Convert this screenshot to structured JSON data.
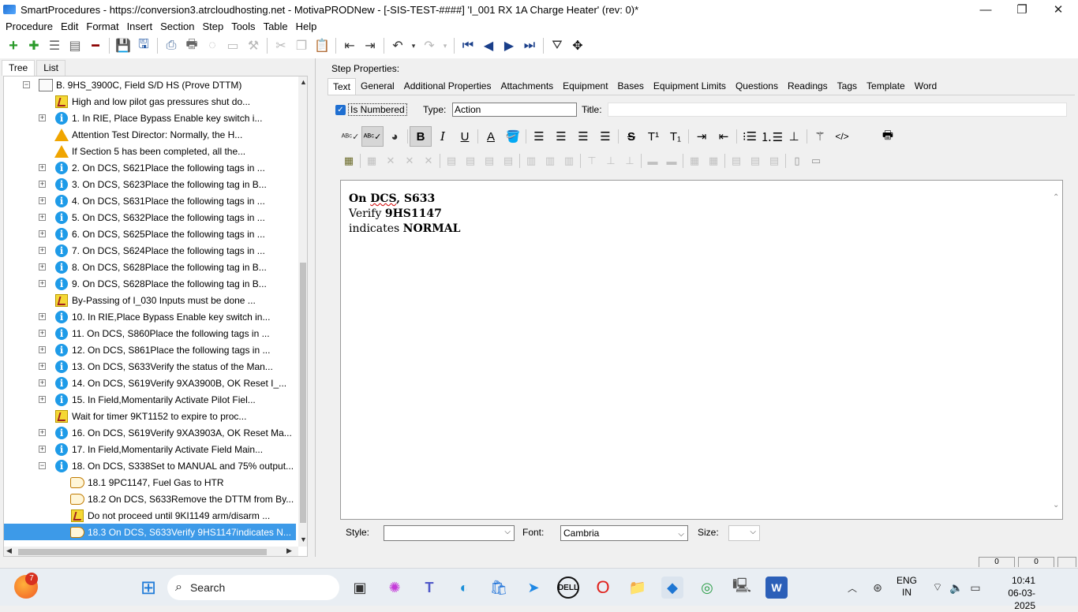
{
  "window": {
    "title": "SmartProcedures - https://conversion3.atrcloudhosting.net - MotivaPRODNew - [-SIS-TEST-####] 'I_001 RX 1A Charge Heater' (rev: 0)*",
    "minimize": "—",
    "maximize": "❐",
    "close": "✕"
  },
  "menu": [
    "Procedure",
    "Edit",
    "Format",
    "Insert",
    "Section",
    "Step",
    "Tools",
    "Table",
    "Help"
  ],
  "left_tabs": [
    "Tree",
    "List"
  ],
  "tree": [
    {
      "label": "B. 9HS_3900C, Field S/D HS (Prove DTTM)",
      "icon": "doc-icon",
      "expander": "−",
      "indent": 44
    },
    {
      "label": "High and low pilot gas pressures shut do...",
      "icon": "note-icon",
      "expander": "",
      "indent": 64
    },
    {
      "label": "1. In RIE, Place Bypass Enable key switch i...",
      "icon": "info-icon",
      "expander": "+",
      "indent": 64
    },
    {
      "label": "Attention Test Director: Normally, the H...",
      "icon": "warning-icon",
      "expander": "",
      "indent": 64
    },
    {
      "label": "If Section 5 has been completed, all the...",
      "icon": "warning-icon",
      "expander": "",
      "indent": 64
    },
    {
      "label": "2. On DCS, S621Place the following tags in ...",
      "icon": "info-icon",
      "expander": "+",
      "indent": 64
    },
    {
      "label": "3. On DCS, S623Place the following tag in B...",
      "icon": "info-icon",
      "expander": "+",
      "indent": 64
    },
    {
      "label": "4. On DCS, S631Place the following tags in ...",
      "icon": "info-icon",
      "expander": "+",
      "indent": 64
    },
    {
      "label": "5. On DCS, S632Place the following tags in ...",
      "icon": "info-icon",
      "expander": "+",
      "indent": 64
    },
    {
      "label": "6. On DCS, S625Place the following tags in ...",
      "icon": "info-icon",
      "expander": "+",
      "indent": 64
    },
    {
      "label": "7. On DCS, S624Place the following tags in ...",
      "icon": "info-icon",
      "expander": "+",
      "indent": 64
    },
    {
      "label": "8. On DCS, S628Place the following tag in B...",
      "icon": "info-icon",
      "expander": "+",
      "indent": 64
    },
    {
      "label": "9. On DCS, S628Place the following tag in B...",
      "icon": "info-icon",
      "expander": "+",
      "indent": 64
    },
    {
      "label": "By-Passing of I_030 Inputs must be done ...",
      "icon": "note-icon",
      "expander": "",
      "indent": 64
    },
    {
      "label": "10. In RIE,Place Bypass Enable key switch in...",
      "icon": "info-icon",
      "expander": "+",
      "indent": 64
    },
    {
      "label": "11. On DCS, S860Place the following tags in ...",
      "icon": "info-icon",
      "expander": "+",
      "indent": 64
    },
    {
      "label": "12. On DCS, S861Place the following tags in ...",
      "icon": "info-icon",
      "expander": "+",
      "indent": 64
    },
    {
      "label": "13. On DCS, S633Verify the status of the Man...",
      "icon": "info-icon",
      "expander": "+",
      "indent": 64
    },
    {
      "label": "14. On DCS, S619Verify 9XA3900B, OK Reset I_...",
      "icon": "info-icon",
      "expander": "+",
      "indent": 64
    },
    {
      "label": "15. In Field,Momentarily Activate Pilot Fiel...",
      "icon": "info-icon",
      "expander": "+",
      "indent": 64
    },
    {
      "label": "Wait for timer 9KT1152 to expire to proc...",
      "icon": "note-icon",
      "expander": "",
      "indent": 64
    },
    {
      "label": "16. On DCS, S619Verify 9XA3903A, OK Reset Ma...",
      "icon": "info-icon",
      "expander": "+",
      "indent": 64
    },
    {
      "label": "17. In Field,Momentarily Activate Field Main...",
      "icon": "info-icon",
      "expander": "+",
      "indent": 64
    },
    {
      "label": "18. On DCS, S338Set to MANUAL and 75% output...",
      "icon": "info-icon",
      "expander": "−",
      "indent": 64
    },
    {
      "label": "18.1 9PC1147, Fuel Gas to HTR",
      "icon": "hand-icon",
      "expander": "",
      "indent": 84
    },
    {
      "label": "18.2 On DCS, S633Remove the DTTM from By...",
      "icon": "hand-icon",
      "expander": "",
      "indent": 84
    },
    {
      "label": "Do not proceed until 9KI1149 arm/disarm ...",
      "icon": "note-icon",
      "expander": "",
      "indent": 84
    },
    {
      "label": "18.3 On DCS, S633Verify 9HS1147indicates N...",
      "icon": "hand-icon",
      "expander": "",
      "indent": 84,
      "selected": true
    }
  ],
  "step_properties": {
    "heading": "Step Properties:",
    "tabs": [
      "Text",
      "General",
      "Additional Properties",
      "Attachments",
      "Equipment",
      "Bases",
      "Equipment Limits",
      "Questions",
      "Readings",
      "Tags",
      "Template",
      "Word"
    ],
    "is_numbered_label": "Is Numbered",
    "is_numbered_checked": true,
    "type_label": "Type:",
    "type_value": "Action",
    "title_label": "Title:",
    "title_value": ""
  },
  "editor": {
    "line1_a": "On ",
    "line1_b": "DCS",
    "line1_c": ", S633",
    "line2_a": "Verify ",
    "line2_b": "9HS1147",
    "line3_a": "indicates ",
    "line3_b": "NORMAL"
  },
  "bottom_fields": {
    "style_label": "Style:",
    "style_value": "",
    "font_label": "Font:",
    "font_value": "Cambria",
    "size_label": "Size:",
    "size_value": ""
  },
  "status": {
    "box1": "0",
    "box2": "0"
  },
  "taskbar": {
    "search_placeholder": "Search",
    "badge": "7",
    "lang_line1": "ENG",
    "lang_line2": "IN",
    "time": "10:41",
    "date": "06-03-2025"
  },
  "colors": {
    "selection": "#3d9ae8",
    "info_icon": "#1e9be8",
    "warning_icon": "#f0a500",
    "checkbox": "#1f6fd1"
  }
}
